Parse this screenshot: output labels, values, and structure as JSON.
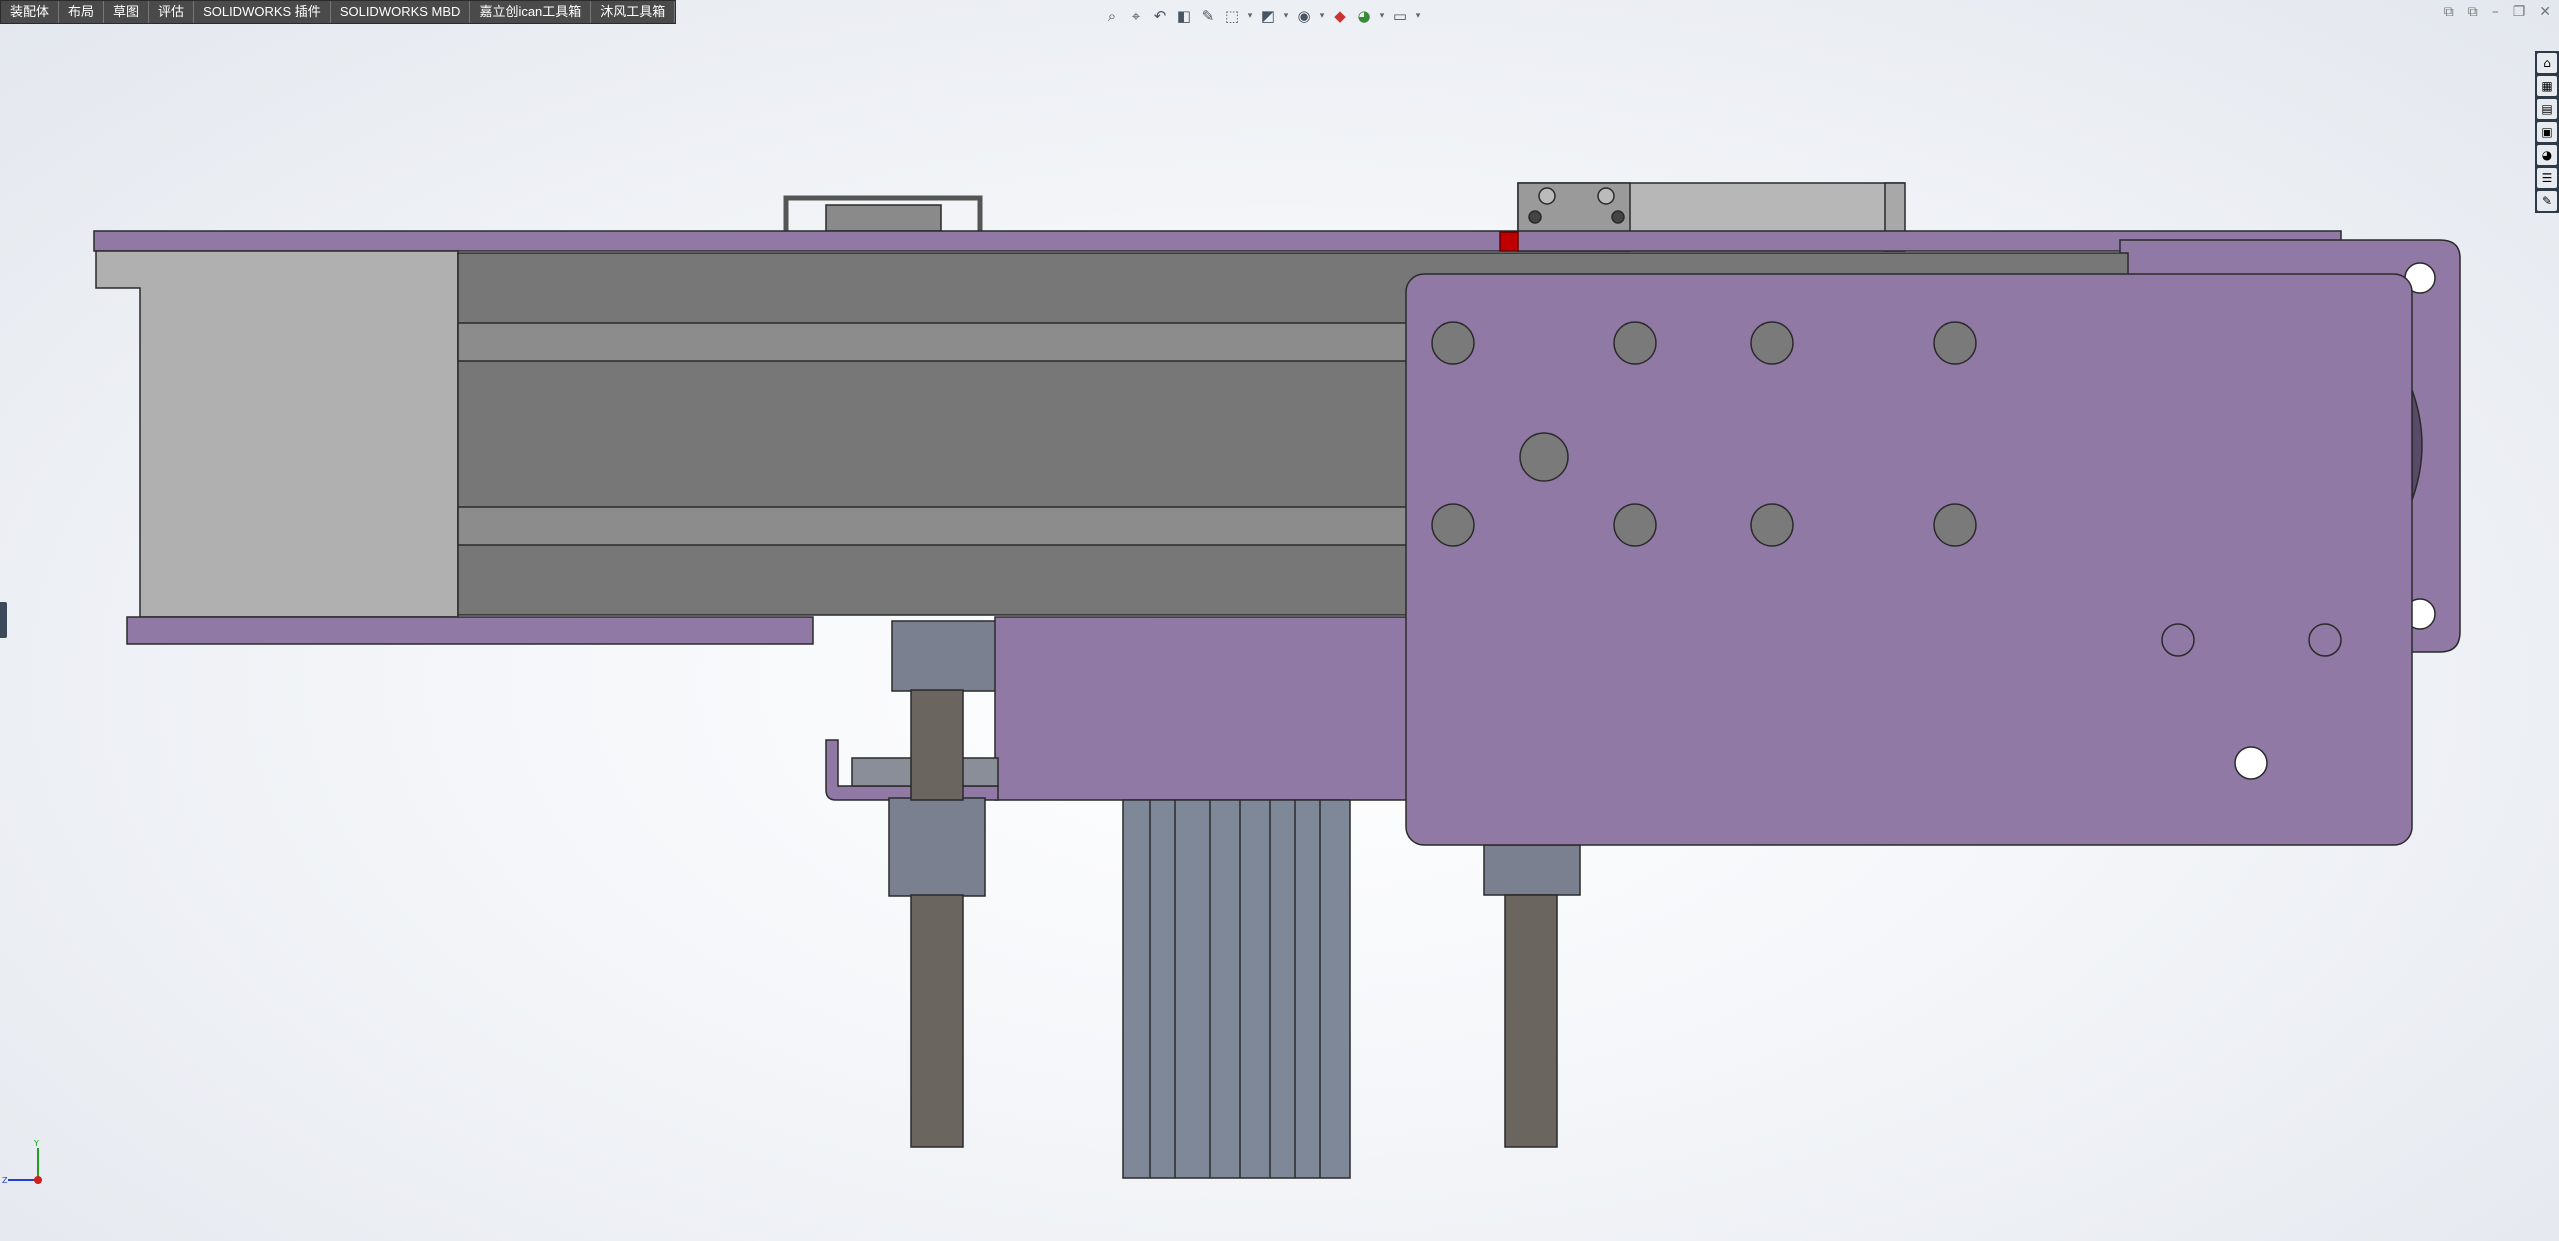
{
  "command_manager": {
    "tabs": [
      {
        "label": "装配体"
      },
      {
        "label": "布局"
      },
      {
        "label": "草图"
      },
      {
        "label": "评估"
      },
      {
        "label": "SOLIDWORKS 插件"
      },
      {
        "label": "SOLIDWORKS MBD"
      },
      {
        "label": "嘉立创ican工具箱"
      },
      {
        "label": "沐风工具箱"
      }
    ]
  },
  "view_toolbar": {
    "icons": [
      "zoom-to-fit-icon",
      "zoom-to-area-icon",
      "previous-view-icon",
      "section-view-icon",
      "dynamic-annotation-icon",
      "view-orientation-icon",
      "display-style-icon",
      "hide-show-items-icon",
      "edit-appearance-icon",
      "apply-scene-icon",
      "view-settings-icon"
    ]
  },
  "window_controls": {
    "icons": [
      "tile-left-icon",
      "tile-right-icon",
      "minimize-icon",
      "restore-icon",
      "close-icon"
    ],
    "glyphs": [
      "⧉",
      "⧉",
      "–",
      "❐",
      "✕"
    ]
  },
  "task_pane": {
    "icons": [
      "solidworks-resources-icon",
      "design-library-icon",
      "file-explorer-icon",
      "view-palette-icon",
      "appearances-icon",
      "custom-properties-icon",
      "solidworks-forum-icon"
    ],
    "glyphs": [
      "⌂",
      "▦",
      "▤",
      "▣",
      "◕",
      "☰",
      "✎"
    ]
  },
  "triad": {
    "y_label": "Y",
    "z_label": "Z"
  },
  "colors": {
    "part_purple": "#9179a6",
    "profile_gray": "#777777",
    "light_gray": "#b0b0b0",
    "rod_gray": "#6b6560",
    "accent_red": "#c00000",
    "triad_x": "#d02020",
    "triad_y": "#20a020",
    "triad_z": "#2040d0"
  }
}
